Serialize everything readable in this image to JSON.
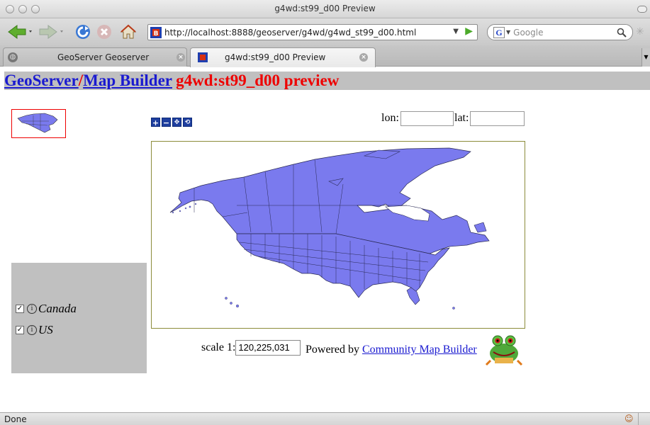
{
  "window": {
    "title": "g4wd:st99_d00 Preview"
  },
  "toolbar": {
    "url": "http://localhost:8888/geoserver/g4wd/g4wd_st99_d00.html",
    "search_placeholder": "Google"
  },
  "tabs": [
    {
      "label": "GeoServer Geoserver",
      "active": false
    },
    {
      "label": "g4wd:st99_d00 Preview",
      "active": true
    }
  ],
  "header": {
    "link1": "GeoServer",
    "separator": "/",
    "link2": "Map Builder",
    "title": "g4wd:st99_d00 preview"
  },
  "coords": {
    "lon_label": "lon:",
    "lat_label": "lat:",
    "lon_value": "",
    "lat_value": ""
  },
  "map": {
    "fill_color": "#7a7aee",
    "stroke_color": "#2a2a55"
  },
  "legend": {
    "items": [
      {
        "label": "Canada",
        "checked": true
      },
      {
        "label": "US",
        "checked": true
      }
    ]
  },
  "scale": {
    "label": "scale 1:",
    "value": "120,225,031"
  },
  "powered": {
    "prefix": "Powered by",
    "link": "Community Map Builder"
  },
  "status": {
    "text": "Done"
  }
}
